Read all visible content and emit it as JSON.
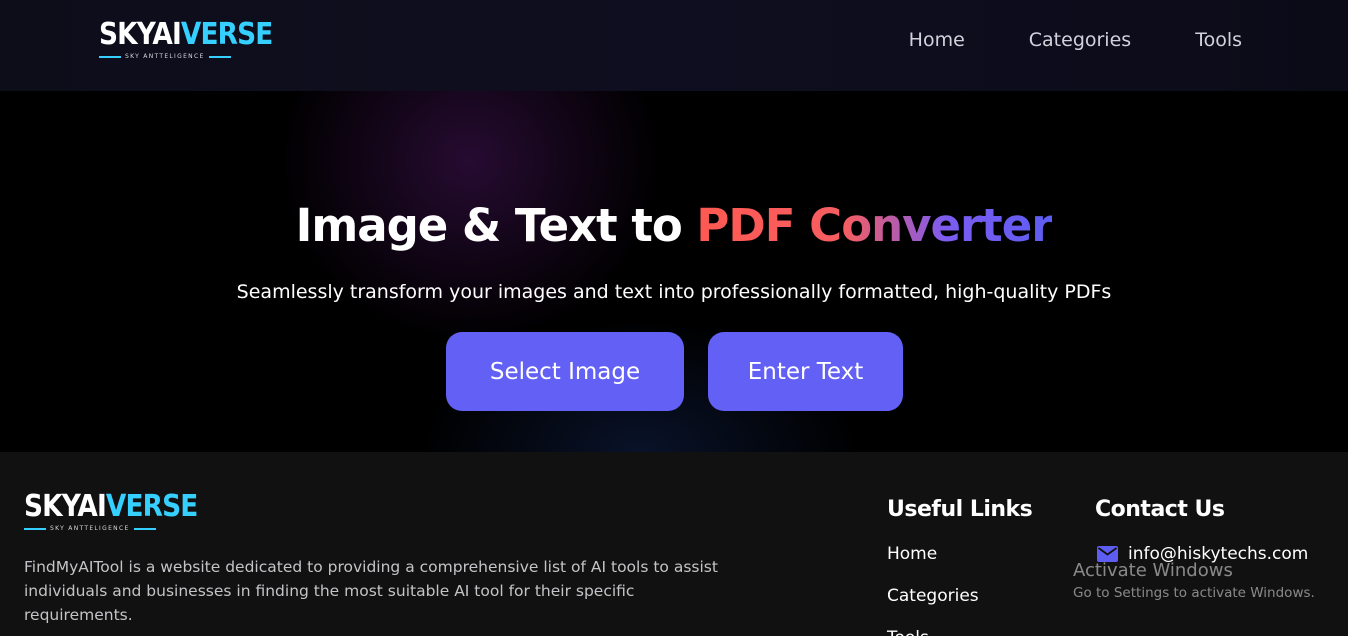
{
  "header": {
    "logo": {
      "main": "SKYAI",
      "accent": "VERSE",
      "tagline": "SKY ANTTELIGENCE"
    },
    "nav": [
      {
        "label": "Home"
      },
      {
        "label": "Categories"
      },
      {
        "label": "Tools"
      }
    ]
  },
  "hero": {
    "title_plain": "Image & Text to ",
    "title_highlight": "PDF Converter",
    "subtitle": "Seamlessly transform your images and text into professionally formatted, high-quality PDFs",
    "buttons": {
      "select_image": "Select Image",
      "enter_text": "Enter Text"
    }
  },
  "footer": {
    "logo": {
      "main": "SKYAI",
      "accent": "VERSE",
      "tagline": "SKY ANTTELIGENCE"
    },
    "description": "FindMyAITool is a website dedicated to providing a comprehensive list of AI tools to assist individuals and businesses in finding the most suitable AI tool for their specific requirements.",
    "useful_links": {
      "heading": "Useful Links",
      "items": [
        "Home",
        "Categories",
        "Tools"
      ]
    },
    "contact": {
      "heading": "Contact Us",
      "email": "info@hiskytechs.com",
      "icon": "mail-icon"
    }
  },
  "watermark": {
    "title": "Activate Windows",
    "subtitle": "Go to Settings to activate Windows."
  },
  "colors": {
    "accent": "#6360f5",
    "logo_accent": "#35d0ff",
    "title_gradient_start": "#ff5a52",
    "title_gradient_end": "#5e5df2"
  }
}
